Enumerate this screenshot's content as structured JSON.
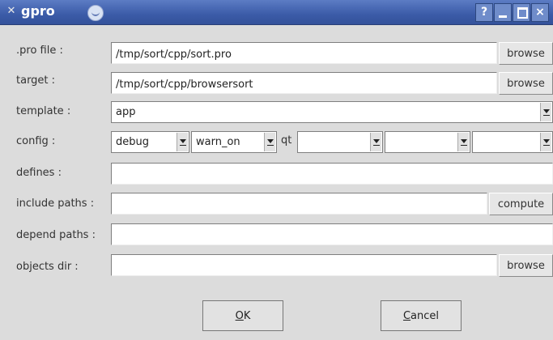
{
  "window": {
    "title": "gpro",
    "buttons": [
      "?",
      "_",
      "□",
      "×"
    ]
  },
  "form": {
    "pro_file": {
      "label": ".pro file :",
      "value": "/tmp/sort/cpp/sort.pro",
      "button": "browse"
    },
    "target": {
      "label": "target :",
      "value": "/tmp/sort/cpp/browsersort",
      "button": "browse"
    },
    "template": {
      "label": "template :",
      "value": "app"
    },
    "config": {
      "label": "config :",
      "debug": "debug",
      "warn": "warn_on",
      "qt_label": "qt"
    },
    "defines": {
      "label": "defines :",
      "value": ""
    },
    "include_paths": {
      "label": "include paths :",
      "value": "",
      "button": "compute"
    },
    "depend_paths": {
      "label": "depend paths :",
      "value": ""
    },
    "objects_dir": {
      "label": "objects dir :",
      "value": "",
      "button": "browse"
    }
  },
  "actions": {
    "ok_accel": "O",
    "ok_rest": "K",
    "cancel_accel": "C",
    "cancel_rest": "ancel"
  },
  "icons": [
    "app-icon",
    "shade-icon",
    "help-icon",
    "minimize-icon",
    "maximize-icon",
    "close-icon",
    "dropdown-arrow-icon"
  ]
}
